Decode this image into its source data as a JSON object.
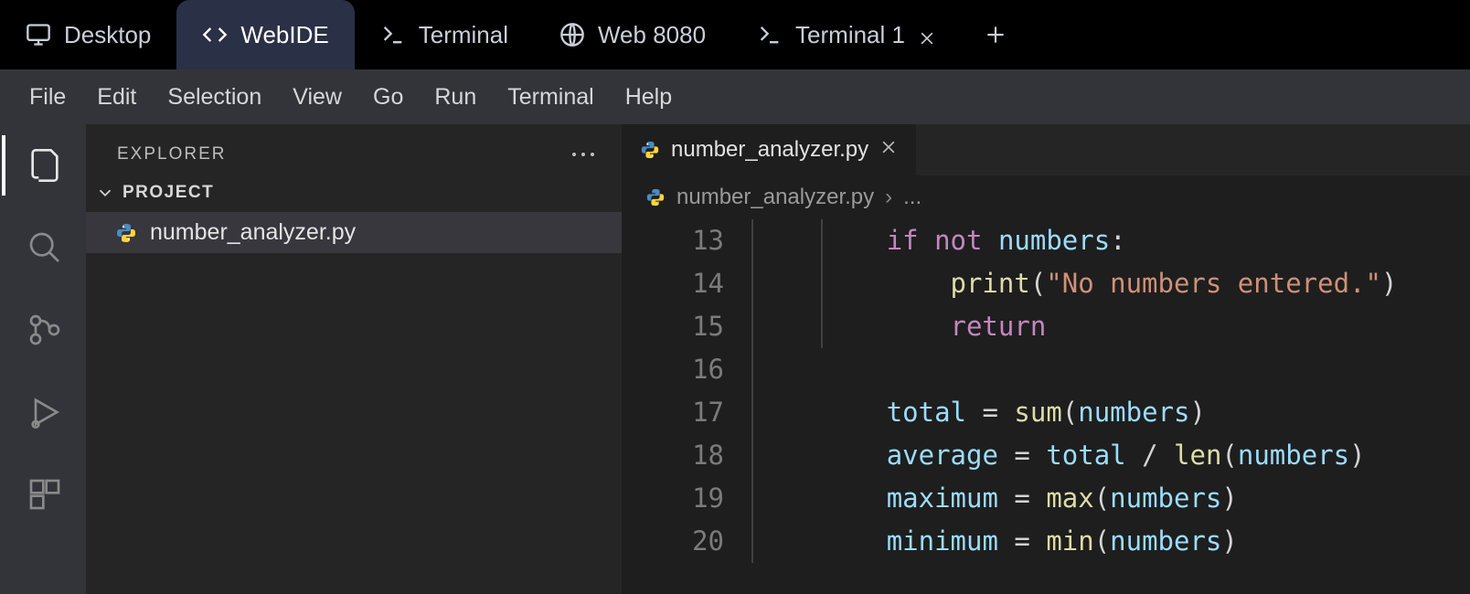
{
  "outer_tabs": {
    "items": [
      {
        "label": "Desktop",
        "icon": "monitor-icon",
        "active": false,
        "closable": false
      },
      {
        "label": "WebIDE",
        "icon": "code-icon",
        "active": true,
        "closable": false
      },
      {
        "label": "Terminal",
        "icon": "prompt-icon",
        "active": false,
        "closable": false
      },
      {
        "label": "Web 8080",
        "icon": "globe-icon",
        "active": false,
        "closable": false
      },
      {
        "label": "Terminal 1",
        "icon": "prompt-icon",
        "active": false,
        "closable": true
      }
    ]
  },
  "menubar": [
    "File",
    "Edit",
    "Selection",
    "View",
    "Go",
    "Run",
    "Terminal",
    "Help"
  ],
  "sidebar": {
    "title": "EXPLORER",
    "section": "PROJECT",
    "files": [
      {
        "name": "number_analyzer.py",
        "icon": "python-icon",
        "selected": true
      }
    ]
  },
  "editor": {
    "tab_label": "number_analyzer.py",
    "breadcrumb_file": "number_analyzer.py",
    "breadcrumb_rest": "...",
    "lines": {
      "start": 13,
      "rows": [
        {
          "n": 13,
          "indent": 2,
          "tokens": [
            [
              "kw",
              "if"
            ],
            [
              "sp",
              " "
            ],
            [
              "kw",
              "not"
            ],
            [
              "sp",
              " "
            ],
            [
              "var",
              "numbers"
            ],
            [
              "pun",
              ":"
            ]
          ]
        },
        {
          "n": 14,
          "indent": 3,
          "tokens": [
            [
              "fn",
              "print"
            ],
            [
              "pun",
              "("
            ],
            [
              "str",
              "\"No numbers entered.\""
            ],
            [
              "pun",
              ")"
            ]
          ]
        },
        {
          "n": 15,
          "indent": 3,
          "tokens": [
            [
              "kw",
              "return"
            ]
          ]
        },
        {
          "n": 16,
          "indent": 0,
          "tokens": []
        },
        {
          "n": 17,
          "indent": 2,
          "tokens": [
            [
              "var",
              "total"
            ],
            [
              "sp",
              " "
            ],
            [
              "op",
              "="
            ],
            [
              "sp",
              " "
            ],
            [
              "fn",
              "sum"
            ],
            [
              "pun",
              "("
            ],
            [
              "var",
              "numbers"
            ],
            [
              "pun",
              ")"
            ]
          ]
        },
        {
          "n": 18,
          "indent": 2,
          "tokens": [
            [
              "var",
              "average"
            ],
            [
              "sp",
              " "
            ],
            [
              "op",
              "="
            ],
            [
              "sp",
              " "
            ],
            [
              "var",
              "total"
            ],
            [
              "sp",
              " "
            ],
            [
              "op",
              "/"
            ],
            [
              "sp",
              " "
            ],
            [
              "fn",
              "len"
            ],
            [
              "pun",
              "("
            ],
            [
              "var",
              "numbers"
            ],
            [
              "pun",
              ")"
            ]
          ]
        },
        {
          "n": 19,
          "indent": 2,
          "tokens": [
            [
              "var",
              "maximum"
            ],
            [
              "sp",
              " "
            ],
            [
              "op",
              "="
            ],
            [
              "sp",
              " "
            ],
            [
              "fn",
              "max"
            ],
            [
              "pun",
              "("
            ],
            [
              "var",
              "numbers"
            ],
            [
              "pun",
              ")"
            ]
          ]
        },
        {
          "n": 20,
          "indent": 2,
          "tokens": [
            [
              "var",
              "minimum"
            ],
            [
              "sp",
              " "
            ],
            [
              "op",
              "="
            ],
            [
              "sp",
              " "
            ],
            [
              "fn",
              "min"
            ],
            [
              "pun",
              "("
            ],
            [
              "var",
              "numbers"
            ],
            [
              "pun",
              ")"
            ]
          ]
        }
      ]
    }
  }
}
